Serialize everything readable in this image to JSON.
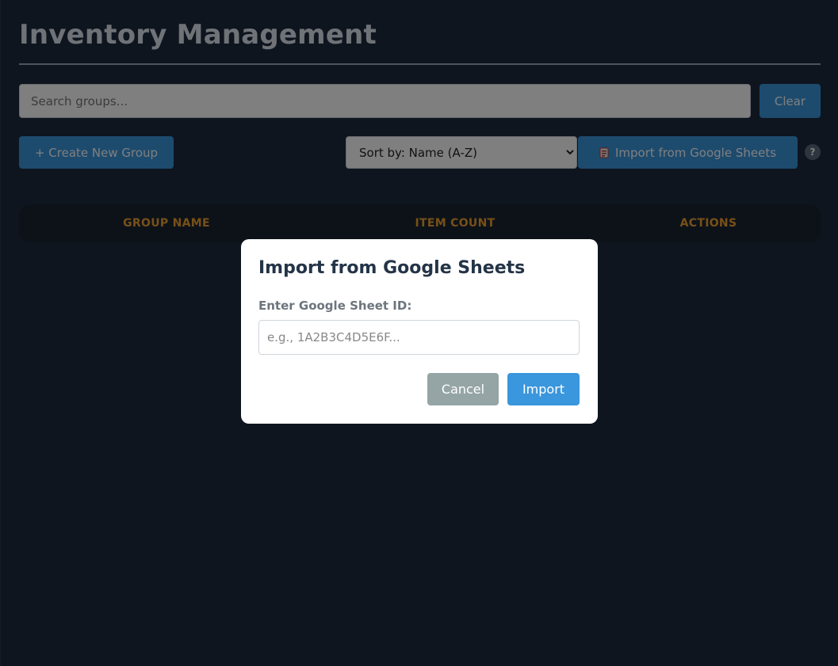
{
  "header": {
    "title": "Inventory Management"
  },
  "search": {
    "placeholder": "Search groups...",
    "value": "",
    "clear_label": "Clear"
  },
  "toolbar": {
    "create_label": "+ Create New Group",
    "sort_selected": "Sort by: Name (A-Z)",
    "import_label": "Import from Google Sheets",
    "import_icon": "spreadsheet-icon",
    "help_label": "?"
  },
  "table": {
    "columns": [
      "GROUP NAME",
      "ITEM COUNT",
      "ACTIONS"
    ],
    "rows": []
  },
  "modal": {
    "title": "Import from Google Sheets",
    "label": "Enter Google Sheet ID:",
    "input_placeholder": "e.g., 1A2B3C4D5E6F...",
    "input_value": "",
    "cancel_label": "Cancel",
    "import_label": "Import"
  },
  "colors": {
    "accent": "#3a96dd",
    "header_text": "#f0a02d",
    "background": "#1c2a3f",
    "cancel": "#95a5a6"
  }
}
